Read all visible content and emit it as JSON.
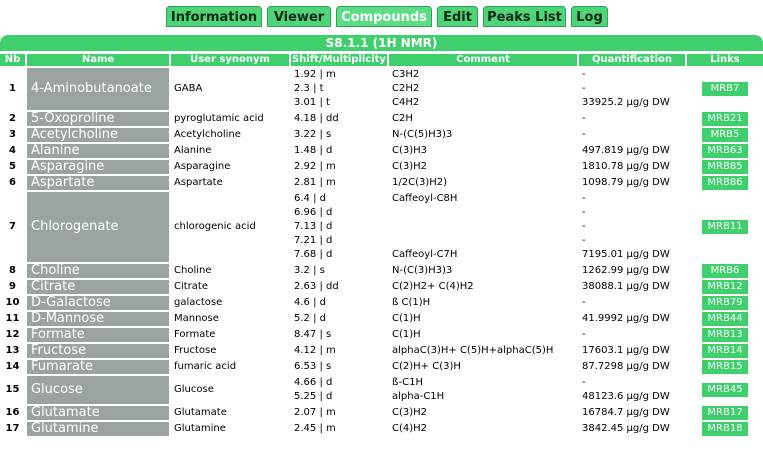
{
  "tabs": [
    "Information",
    "Viewer",
    "Compounds",
    "Edit",
    "Peaks List",
    "Log"
  ],
  "active_tab": "Compounds",
  "section_title": "S8.1.1 (1H NMR)",
  "columns": [
    "Nb",
    "Name",
    "User synonym",
    "Shift/Multiplicity",
    "Comment",
    "Quantification",
    "Links"
  ],
  "rows": [
    {
      "nb": "1",
      "name": "4-Aminobutanoate",
      "synonym": "GABA",
      "shifts": [
        "1.92 | m",
        "2.3 | t",
        "3.01 | t"
      ],
      "comments": [
        "C3H2",
        "C2H2",
        "C4H2"
      ],
      "quants": [
        "-",
        "-",
        "33925.2 µg/g DW"
      ],
      "link": "MRB7"
    },
    {
      "nb": "2",
      "name": "5-Oxoproline",
      "synonym": "pyroglutamic acid",
      "shifts": [
        "4.18 | dd"
      ],
      "comments": [
        "C2H"
      ],
      "quants": [
        "-"
      ],
      "link": "MRB21"
    },
    {
      "nb": "3",
      "name": "Acetylcholine",
      "synonym": "Acetylcholine",
      "shifts": [
        "3.22 | s"
      ],
      "comments": [
        "N-(C(5)H3)3"
      ],
      "quants": [
        "-"
      ],
      "link": "MRB5"
    },
    {
      "nb": "4",
      "name": "Alanine",
      "synonym": "Alanine",
      "shifts": [
        "1.48 | d"
      ],
      "comments": [
        "C(3)H3"
      ],
      "quants": [
        "497.819 µg/g DW"
      ],
      "link": "MRB63"
    },
    {
      "nb": "5",
      "name": "Asparagine",
      "synonym": "Asparagine",
      "shifts": [
        "2.92 | m"
      ],
      "comments": [
        "C(3)H2"
      ],
      "quants": [
        "1810.78 µg/g DW"
      ],
      "link": "MRB85"
    },
    {
      "nb": "6",
      "name": "Aspartate",
      "synonym": "Aspartate",
      "shifts": [
        "2.81 | m"
      ],
      "comments": [
        "1/2C(3)H2)"
      ],
      "quants": [
        "1098.79 µg/g DW"
      ],
      "link": "MRB86"
    },
    {
      "nb": "7",
      "name": "Chlorogenate",
      "synonym": "chlorogenic acid",
      "shifts": [
        "6.4 | d",
        "6.96 | d",
        "7.13 | d",
        "7.21 | d",
        "7.68 | d"
      ],
      "comments": [
        "Caffeoyl-C8H",
        "",
        "",
        "",
        "Caffeoyl-C7H"
      ],
      "quants": [
        "-",
        "-",
        "-",
        "-",
        "7195.01 µg/g DW"
      ],
      "link": "MRB11"
    },
    {
      "nb": "8",
      "name": "Choline",
      "synonym": "Choline",
      "shifts": [
        "3.2 | s"
      ],
      "comments": [
        "N-(C(3)H3)3"
      ],
      "quants": [
        "1262.99 µg/g DW"
      ],
      "link": "MRB6"
    },
    {
      "nb": "9",
      "name": "Citrate",
      "synonym": "Citrate",
      "shifts": [
        "2.63 | dd"
      ],
      "comments": [
        "C(2)H2+ C(4)H2"
      ],
      "quants": [
        "38088.1 µg/g DW"
      ],
      "link": "MRB12"
    },
    {
      "nb": "10",
      "name": "D-Galactose",
      "synonym": "galactose",
      "shifts": [
        "4.6 | d"
      ],
      "comments": [
        "ß C(1)H"
      ],
      "quants": [
        "-"
      ],
      "link": "MRB79"
    },
    {
      "nb": "11",
      "name": "D-Mannose",
      "synonym": "Mannose",
      "shifts": [
        "5.2 | d"
      ],
      "comments": [
        "C(1)H"
      ],
      "quants": [
        "41.9992 µg/g DW"
      ],
      "link": "MRB44"
    },
    {
      "nb": "12",
      "name": "Formate",
      "synonym": "Formate",
      "shifts": [
        "8.47 | s"
      ],
      "comments": [
        "C(1)H"
      ],
      "quants": [
        "-"
      ],
      "link": "MRB13"
    },
    {
      "nb": "13",
      "name": "Fructose",
      "synonym": "Fructose",
      "shifts": [
        "4.12 | m"
      ],
      "comments": [
        "alphaC(3)H+ C(5)H+alphaC(5)H"
      ],
      "quants": [
        "17603.1 µg/g DW"
      ],
      "link": "MRB14"
    },
    {
      "nb": "14",
      "name": "Fumarate",
      "synonym": "fumaric acid",
      "shifts": [
        "6.53 | s"
      ],
      "comments": [
        "C(2)H+ C(3)H"
      ],
      "quants": [
        "87.7298 µg/g DW"
      ],
      "link": "MRB15"
    },
    {
      "nb": "15",
      "name": "Glucose",
      "synonym": "Glucose",
      "shifts": [
        "4.66 | d",
        "5.25 | d"
      ],
      "comments": [
        "ß-C1H",
        "alpha-C1H"
      ],
      "quants": [
        "-",
        "48123.6 µg/g DW"
      ],
      "link": "MRB45"
    },
    {
      "nb": "16",
      "name": "Glutamate",
      "synonym": "Glutamate",
      "shifts": [
        "2.07 | m"
      ],
      "comments": [
        "C(3)H2"
      ],
      "quants": [
        "16784.7 µg/g DW"
      ],
      "link": "MRB17"
    },
    {
      "nb": "17",
      "name": "Glutamine",
      "synonym": "Glutamine",
      "shifts": [
        "2.45 | m"
      ],
      "comments": [
        "C(4)H2"
      ],
      "quants": [
        "3842.45 µg/g DW"
      ],
      "link": "MRB18"
    }
  ]
}
